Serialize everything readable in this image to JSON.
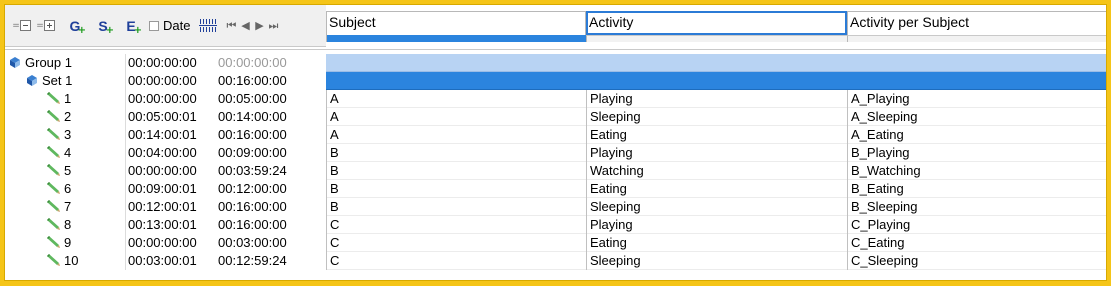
{
  "toolbar": {
    "buttons": [
      {
        "name": "collapse-all-icon"
      },
      {
        "name": "expand-all-icon"
      },
      {
        "letter": "G",
        "name": "add-group-button"
      },
      {
        "letter": "S",
        "name": "add-set-button"
      },
      {
        "letter": "E",
        "name": "add-event-button"
      }
    ],
    "date_label": "Date",
    "date_checked": false
  },
  "columns": [
    "Subject",
    "Activity",
    "Activity per Subject"
  ],
  "tree": {
    "group": {
      "label": "Group 1",
      "start": "00:00:00:00",
      "end": "00:00:00:00"
    },
    "set": {
      "label": "Set 1",
      "start": "00:00:00:00",
      "end": "00:16:00:00"
    },
    "events": [
      {
        "id": "1",
        "start": "00:00:00:00",
        "end": "00:05:00:00",
        "subject": "A",
        "activity": "Playing",
        "aps": "A_Playing"
      },
      {
        "id": "2",
        "start": "00:05:00:01",
        "end": "00:14:00:00",
        "subject": "A",
        "activity": "Sleeping",
        "aps": "A_Sleeping"
      },
      {
        "id": "3",
        "start": "00:14:00:01",
        "end": "00:16:00:00",
        "subject": "A",
        "activity": "Eating",
        "aps": "A_Eating"
      },
      {
        "id": "4",
        "start": "00:04:00:00",
        "end": "00:09:00:00",
        "subject": "B",
        "activity": "Playing",
        "aps": "B_Playing"
      },
      {
        "id": "5",
        "start": "00:00:00:00",
        "end": "00:03:59:24",
        "subject": "B",
        "activity": "Watching",
        "aps": "B_Watching"
      },
      {
        "id": "6",
        "start": "00:09:00:01",
        "end": "00:12:00:00",
        "subject": "B",
        "activity": "Eating",
        "aps": "B_Eating"
      },
      {
        "id": "7",
        "start": "00:12:00:01",
        "end": "00:16:00:00",
        "subject": "B",
        "activity": "Sleeping",
        "aps": "B_Sleeping"
      },
      {
        "id": "8",
        "start": "00:13:00:01",
        "end": "00:16:00:00",
        "subject": "C",
        "activity": "Playing",
        "aps": "C_Playing"
      },
      {
        "id": "9",
        "start": "00:00:00:00",
        "end": "00:03:00:00",
        "subject": "C",
        "activity": "Eating",
        "aps": "C_Eating"
      },
      {
        "id": "10",
        "start": "00:03:00:01",
        "end": "00:12:59:24",
        "subject": "C",
        "activity": "Sleeping",
        "aps": "C_Sleeping"
      }
    ]
  },
  "colors": {
    "frame": "#f5c518",
    "set_band": "#2b84de",
    "group_band": "#b8d3f3"
  }
}
